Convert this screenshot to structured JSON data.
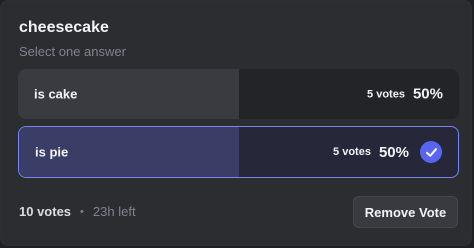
{
  "poll": {
    "question": "cheesecake",
    "hint": "Select one answer",
    "answers": [
      {
        "label": "is cake",
        "votes": "5 votes",
        "percent": "50%",
        "fill_fraction": 0.5,
        "selected": false
      },
      {
        "label": "is pie",
        "votes": "5 votes",
        "percent": "50%",
        "fill_fraction": 0.5,
        "selected": true
      }
    ],
    "footer": {
      "total_votes": "10 votes",
      "separator": "•",
      "time_left": "23h left"
    },
    "remove_vote_label": "Remove Vote",
    "icons": {
      "selected": "checkmark-icon"
    },
    "colors": {
      "accent": "#5865f2",
      "selected_border": "#7884f0",
      "background": "#2b2d31"
    }
  }
}
